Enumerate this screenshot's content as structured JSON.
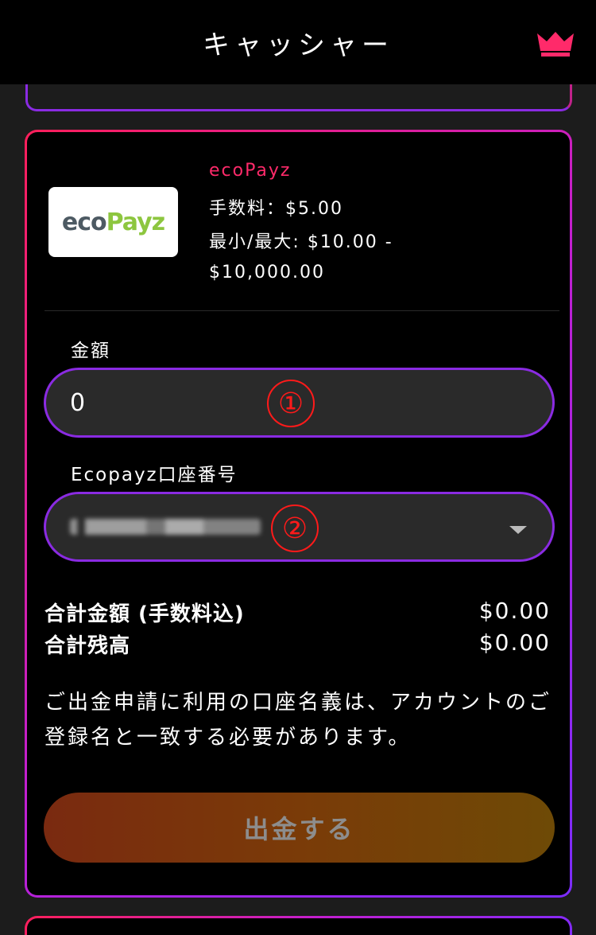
{
  "header": {
    "title": "キャッシャー",
    "crown_icon": "crown-icon",
    "accent": "#ff2a6a"
  },
  "method": {
    "logo_text_left": "eco",
    "logo_text_right": "Payz",
    "name": "ecoPayz",
    "fee": "手数料：$5.00",
    "range": "最小/最大: $10.00 - $10,000.00"
  },
  "form": {
    "amount_label": "金額",
    "amount_value": "0",
    "account_label": "Ecopayz口座番号",
    "marker_1": "①",
    "marker_2": "②"
  },
  "summary": {
    "total_label": "合計金額 (手数料込)",
    "total_value": "$0.00",
    "balance_label": "合計残高",
    "balance_value": "$0.00"
  },
  "notice": "ご出金申請に利用の口座名義は、アカウントのご登録名と一致する必要があります。",
  "submit_label": "出金する"
}
